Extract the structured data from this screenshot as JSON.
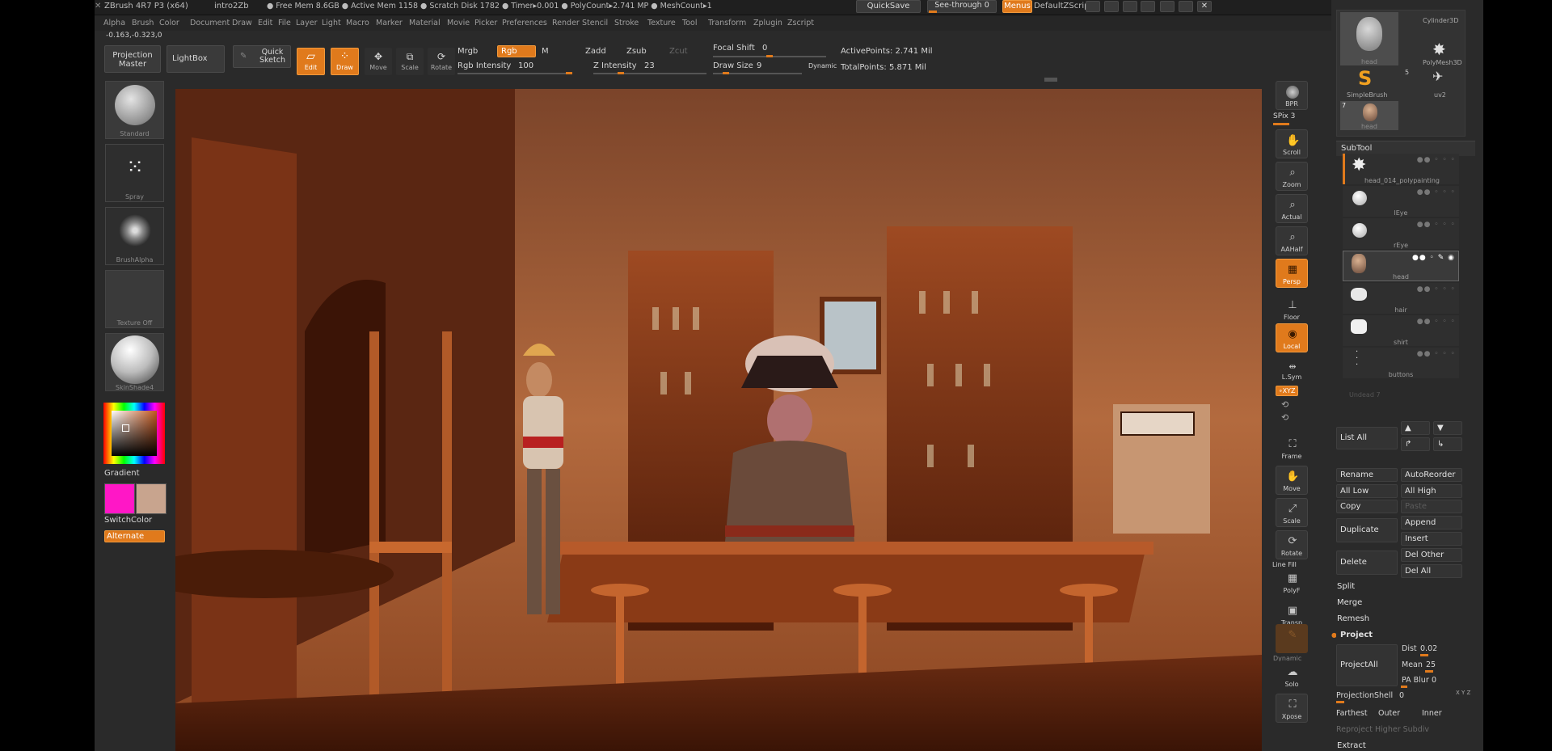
{
  "title": {
    "app": "ZBrush 4R7 P3 (x64)",
    "file": "intro2Zb",
    "stats": "● Free Mem 8.6GB ● Active Mem 1158 ● Scratch Disk 1782 ● Timer▸0.001 ● PolyCount▸2.741 MP ● MeshCount▸1",
    "quicksave": "QuickSave",
    "seethrough": "See-through 0",
    "menus": "Menus",
    "script": "DefaultZScript"
  },
  "menus": [
    "Alpha",
    "Brush",
    "Color",
    "Document",
    "Draw",
    "Edit",
    "File",
    "Layer",
    "Light",
    "Macro",
    "Marker",
    "Material",
    "Movie",
    "Picker",
    "Preferences",
    "Render",
    "Stencil",
    "Stroke",
    "Texture",
    "Tool",
    "Transform",
    "Zplugin",
    "Zscript"
  ],
  "coords": "-0.163,-0.323,0",
  "top_shelf": {
    "projection_master": "Projection Master",
    "lightbox": "LightBox",
    "quick_sketch": "Quick Sketch",
    "edit": "Edit",
    "draw": "Draw",
    "move": "Move",
    "scale": "Scale",
    "rotate": "Rotate",
    "mrgb": "Mrgb",
    "rgb": "Rgb",
    "m": "M",
    "zadd": "Zadd",
    "zsub": "Zsub",
    "zcut": "Zcut",
    "rgb_intensity_label": "Rgb Intensity",
    "rgb_intensity_value": "100",
    "z_intensity_label": "Z Intensity",
    "z_intensity_value": "23",
    "focal_shift_label": "Focal Shift",
    "focal_shift_value": "0",
    "draw_size_label": "Draw Size",
    "draw_size_value": "9",
    "dynamic": "Dynamic",
    "active_points": "ActivePoints: 2.741 Mil",
    "total_points": "TotalPoints: 5.871 Mil"
  },
  "left_shelf": {
    "standard": "Standard",
    "spray": "Spray",
    "brush_alpha": "BrushAlpha",
    "texture_off": "Texture Off",
    "material": "SkinShade4",
    "gradient": "Gradient",
    "switch_color": "SwitchColor",
    "alternate": "Alternate",
    "main_color": "#ff17c6",
    "secondary_color": "#c8a48e"
  },
  "right_shelf": {
    "bpr": "BPR",
    "spix": "SPix 3",
    "scroll": "Scroll",
    "zoom": "Zoom",
    "actual": "Actual",
    "aahalf": "AAHalf",
    "persp": "Persp",
    "floor": "Floor",
    "local": "Local",
    "lsym": "L.Sym",
    "xyz": "∘XYZ",
    "frame": "Frame",
    "move": "Move",
    "scale": "Scale",
    "rotate": "Rotate",
    "line_fill": "Line Fill",
    "polyf": "PolyF",
    "transp": "Transp",
    "dynamic": "Dynamic",
    "solo": "Solo",
    "xpose": "Xpose"
  },
  "tool_panel": {
    "tools": [
      {
        "name": "head"
      },
      {
        "name": "Cylinder3D"
      },
      {
        "name": "PolyMesh3D"
      },
      {
        "name": "SimpleBrush"
      },
      {
        "name": "uv2"
      },
      {
        "name": "head"
      }
    ],
    "tool_count": "5",
    "tool_count2": "7",
    "subtool_title": "SubTool",
    "subtools": [
      {
        "name": "head_014_polypainting"
      },
      {
        "name": "lEye"
      },
      {
        "name": "rEye"
      },
      {
        "name": "head"
      },
      {
        "name": "hair"
      },
      {
        "name": "shirt"
      },
      {
        "name": "buttons"
      }
    ],
    "undead": "Undead 7",
    "list_all": "List All",
    "rename": "Rename",
    "auto_reorder": "AutoReorder",
    "all_low": "All Low",
    "all_high": "All High",
    "copy": "Copy",
    "paste": "Paste",
    "duplicate": "Duplicate",
    "append": "Append",
    "insert": "Insert",
    "delete": "Delete",
    "del_other": "Del Other",
    "del_all": "Del All",
    "split": "Split",
    "merge": "Merge",
    "remesh": "Remesh",
    "project": "Project",
    "project_all": "ProjectAll",
    "dist_label": "Dist",
    "dist_value": "0.02",
    "mean_label": "Mean",
    "mean_value": "25",
    "pa_blur_label": "PA Blur",
    "pa_blur_value": "0",
    "projection_shell_label": "ProjectionShell",
    "projection_shell_value": "0",
    "xyz_small": "X Y Z",
    "farthest": "Farthest",
    "outer": "Outer",
    "inner": "Inner",
    "reproject": "Reproject Higher Subdiv",
    "extract": "Extract"
  }
}
